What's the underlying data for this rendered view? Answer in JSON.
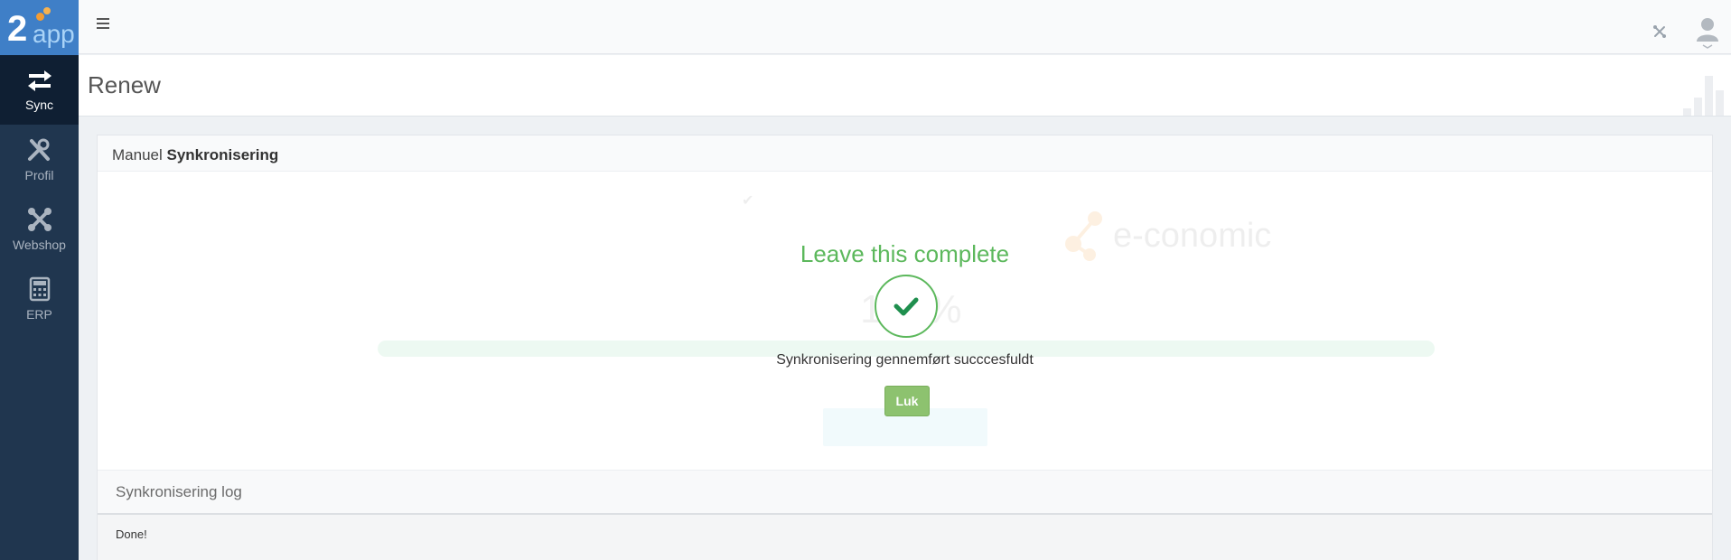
{
  "logo": {
    "two": "2",
    "app": "app"
  },
  "sidebar": {
    "items": [
      {
        "label": "Sync",
        "icon": "exchange-icon",
        "active": true
      },
      {
        "label": "Profil",
        "icon": "wrench-icon",
        "active": false
      },
      {
        "label": "Webshop",
        "icon": "joomla-icon",
        "active": false
      },
      {
        "label": "ERP",
        "icon": "calculator-icon",
        "active": false
      }
    ]
  },
  "header": {
    "title": "Renew"
  },
  "panel": {
    "title_prefix": "Manuel",
    "title_bold": "Synkronisering"
  },
  "background": {
    "brand": "e-conomic",
    "progress_text": "100%",
    "progress_value": 1.0
  },
  "modal": {
    "title": "Leave this complete",
    "message": "Synkronisering gennemført succcesfuldt",
    "close_label": "Luk"
  },
  "log": {
    "title": "Synkronisering log",
    "content": "Done!"
  },
  "colors": {
    "sidebar": "#20364f",
    "sidebar_active": "#0f1f33",
    "logo_bg": "#3f7fc7",
    "success": "#5cb85c",
    "button": "#8dc26f"
  }
}
